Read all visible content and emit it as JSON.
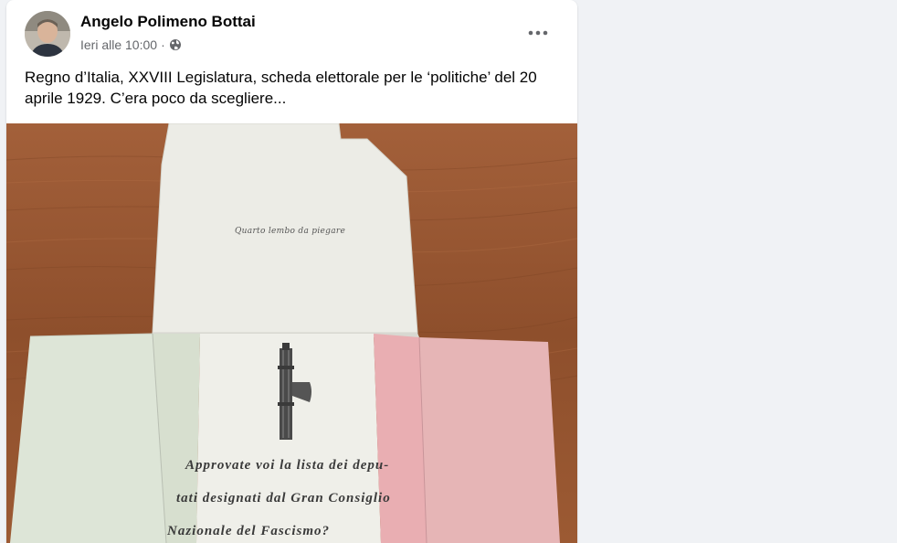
{
  "post": {
    "author": "Angelo Polimeno Bottai",
    "timestamp": "Ieri alle 10:00",
    "separator": "·",
    "privacy_icon": "globe-icon",
    "menu_icon": "more-options-icon",
    "caption": "Regno d’Italia, XXVIII Legislatura, scheda elettorale per le ‘politiche’ del 20 aprile 1929. C’era poco da scegliere..."
  },
  "photo": {
    "flap_text": "Quarto lembo da piegare",
    "question_lines": [
      "Approvate voi la lista dei depu-",
      "tati designati dal Gran Consiglio",
      "Nazionale del Fascismo?"
    ]
  },
  "colors": {
    "page_background": "#f0f2f5",
    "card_background": "#ffffff",
    "text_primary": "#050505",
    "text_secondary": "#65676b",
    "ballot_green": "#dde5d7",
    "ballot_white": "#eeeee8",
    "ballot_red": "#e7aeb0"
  }
}
